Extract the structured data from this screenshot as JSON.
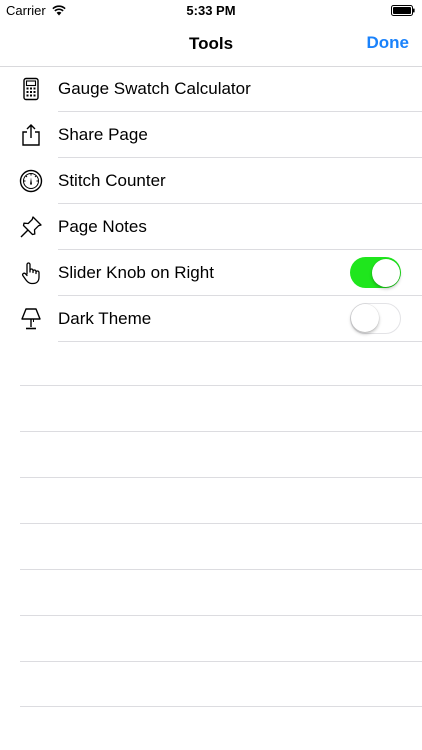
{
  "status_bar": {
    "carrier": "Carrier",
    "time": "5:33 PM"
  },
  "nav": {
    "title": "Tools",
    "done_label": "Done"
  },
  "colors": {
    "accent": "#1a82fb",
    "toggle_on": "#1fe61d"
  },
  "rows": [
    {
      "label": "Gauge Swatch Calculator",
      "icon": "calculator-icon"
    },
    {
      "label": "Share Page",
      "icon": "share-icon"
    },
    {
      "label": "Stitch Counter",
      "icon": "counter-dial-icon"
    },
    {
      "label": "Page Notes",
      "icon": "pushpin-icon"
    },
    {
      "label": "Slider Knob on Right",
      "icon": "hand-pointer-icon",
      "toggle": true
    },
    {
      "label": "Dark Theme",
      "icon": "lamp-icon",
      "toggle": false
    }
  ]
}
